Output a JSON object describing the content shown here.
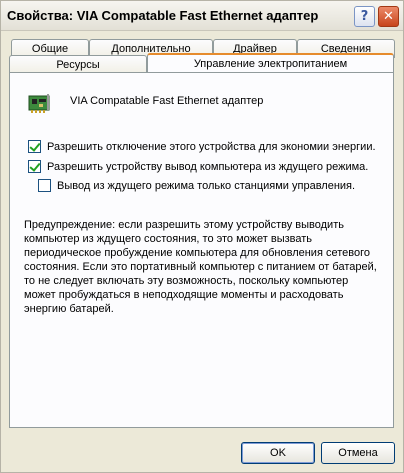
{
  "window": {
    "title": "Свойства: VIA Compatable Fast Ethernet адаптер",
    "help_glyph": "?",
    "close_glyph": "✕"
  },
  "tabs": {
    "row_top": [
      "Общие",
      "Дополнительно",
      "Драйвер",
      "Сведения"
    ],
    "row_bottom": [
      "Ресурсы",
      "Управление электропитанием"
    ],
    "active": "Управление электропитанием"
  },
  "panel": {
    "device_icon": "network-card-icon",
    "device_name": "VIA Compatable Fast Ethernet адаптер",
    "options": [
      {
        "label": "Разрешить отключение этого устройства для экономии энергии.",
        "checked": true
      },
      {
        "label": "Разрешить устройству вывод компьютера из ждущего режима.",
        "checked": true
      },
      {
        "label": "Вывод из ждущего режима только станциями управления.",
        "checked": false
      }
    ],
    "warning_lines": [
      "Предупреждение: если разрешить этому устройству выводить",
      "компьютер из ждущего состояния, то это может вызвать",
      "периодическое пробуждение компьютера для обновления сетевого",
      "состояния. Если это портативный компьютер с питанием от батарей,",
      "то не следует включать эту возможность, поскольку компьютер",
      "может пробуждаться в неподходящие моменты и расходовать",
      "энергию батарей."
    ]
  },
  "buttons": {
    "ok": "OK",
    "cancel": "Отмена"
  },
  "colors": {
    "accent_tab": "#e68b2c",
    "check_green": "#21a121",
    "close_red": "#c7441c"
  }
}
